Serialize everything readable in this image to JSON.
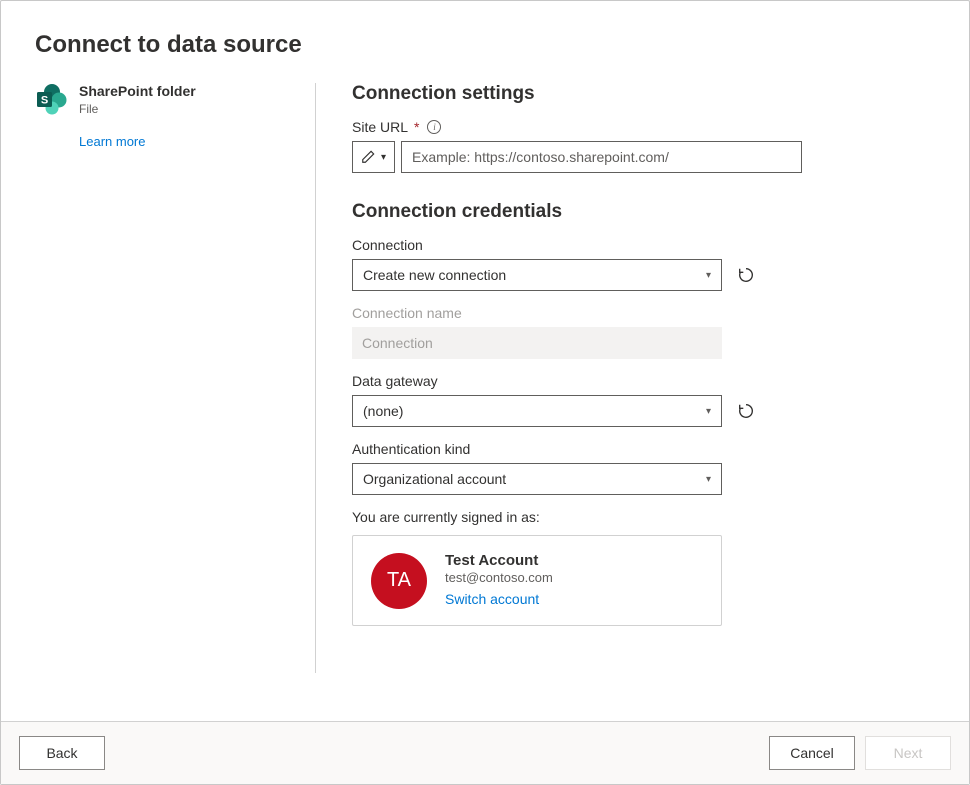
{
  "dialog": {
    "title": "Connect to data source"
  },
  "source": {
    "name": "SharePoint folder",
    "subtype": "File",
    "learn_more": "Learn more"
  },
  "settings": {
    "heading": "Connection settings",
    "site_url_label": "Site URL",
    "site_url_placeholder": "Example: https://contoso.sharepoint.com/"
  },
  "credentials": {
    "heading": "Connection credentials",
    "connection_label": "Connection",
    "connection_value": "Create new connection",
    "connection_name_label": "Connection name",
    "connection_name_value": "Connection",
    "gateway_label": "Data gateway",
    "gateway_value": "(none)",
    "auth_label": "Authentication kind",
    "auth_value": "Organizational account"
  },
  "account": {
    "signedin_text": "You are currently signed in as:",
    "initials": "TA",
    "name": "Test Account",
    "email": "test@contoso.com",
    "switch": "Switch account"
  },
  "footer": {
    "back": "Back",
    "cancel": "Cancel",
    "next": "Next"
  }
}
